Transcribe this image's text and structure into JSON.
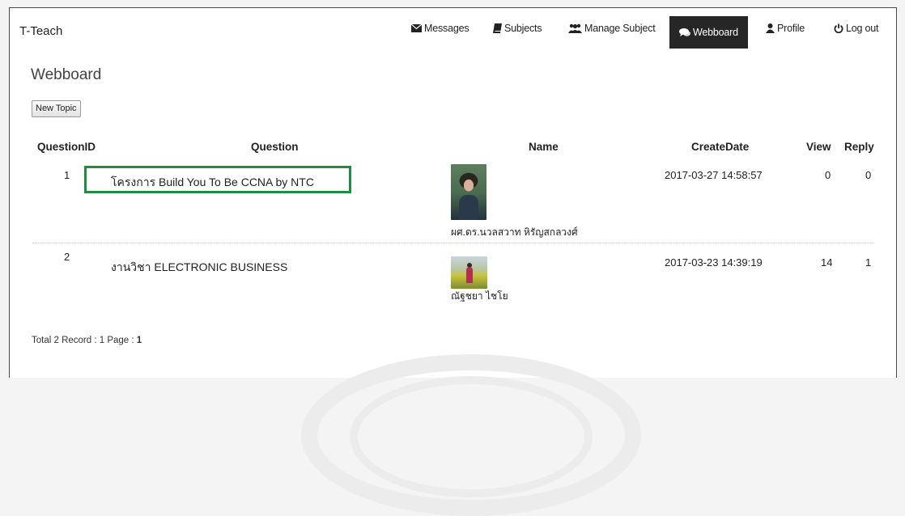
{
  "brand": "T-Teach",
  "nav": [
    {
      "icon": "envelope-icon",
      "label": "Messages"
    },
    {
      "icon": "book-icon",
      "label": "Subjects"
    },
    {
      "icon": "users-icon",
      "label": "Manage Subject"
    },
    {
      "icon": "comments-icon",
      "label": "Webboard",
      "active": true
    },
    {
      "icon": "user-icon",
      "label": "Profile"
    },
    {
      "icon": "power-icon",
      "label": "Log out"
    }
  ],
  "page_title": "Webboard",
  "new_topic_label": "New Topic",
  "table": {
    "headers": [
      "QuestionID",
      "Question",
      "Name",
      "CreateDate",
      "View",
      "Reply"
    ],
    "rows": [
      {
        "id": "1",
        "question": "โครงการ Build You To Be CCNA by NTC",
        "name": "ผศ.ดร.นวลสวาท หิรัญสกลวงศ์",
        "date": "2017-03-27 14:58:57",
        "view": "0",
        "reply": "0"
      },
      {
        "id": "2",
        "question": "งานวิชา ELECTRONIC BUSINESS",
        "name": "ณัฐชยา ไชโย",
        "date": "2017-03-23 14:39:19",
        "view": "14",
        "reply": "1"
      }
    ]
  },
  "footer": {
    "text": "Total 2 Record : 1 Page :",
    "page": "1"
  },
  "colors": {
    "active_nav": "#262626",
    "highlight_box": "#1f8d3f"
  }
}
